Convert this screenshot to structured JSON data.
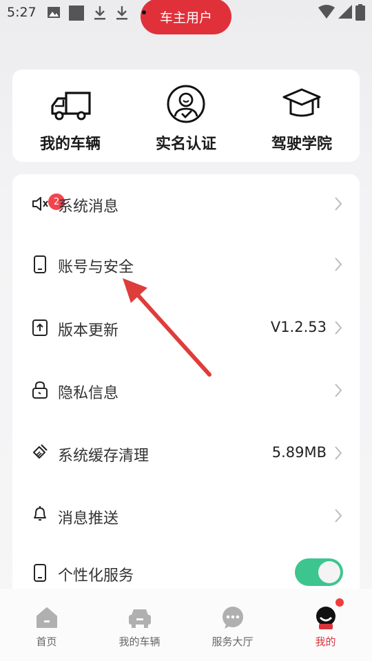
{
  "status_bar": {
    "time": "5:27"
  },
  "header": {
    "role_label": "车主用户"
  },
  "quick_actions": [
    {
      "label": "我的车辆",
      "icon": "truck-icon"
    },
    {
      "label": "实名认证",
      "icon": "user-verify-icon"
    },
    {
      "label": "驾驶学院",
      "icon": "graduation-cap-icon"
    }
  ],
  "menu": {
    "items": [
      {
        "label": "系统消息",
        "icon": "speaker-icon",
        "badge": "2",
        "value": ""
      },
      {
        "label": "账号与安全",
        "icon": "phone-icon",
        "value": ""
      },
      {
        "label": "版本更新",
        "icon": "upload-icon",
        "value": "V1.2.53"
      },
      {
        "label": "隐私信息",
        "icon": "lock-icon",
        "value": ""
      },
      {
        "label": "系统缓存清理",
        "icon": "broom-icon",
        "value": "5.89MB"
      },
      {
        "label": "消息推送",
        "icon": "bell-icon",
        "value": ""
      },
      {
        "label": "个性化服务",
        "icon": "phone-icon",
        "toggle": "on"
      }
    ]
  },
  "bottom_nav": {
    "items": [
      {
        "label": "首页",
        "icon": "home-icon"
      },
      {
        "label": "我的车辆",
        "icon": "car-icon"
      },
      {
        "label": "服务大厅",
        "icon": "chat-icon"
      },
      {
        "label": "我的",
        "icon": "profile-icon",
        "active": true
      }
    ]
  },
  "colors": {
    "accent": "#e0313b",
    "toggle_on": "#3dc58e",
    "badge": "#f2454e"
  }
}
